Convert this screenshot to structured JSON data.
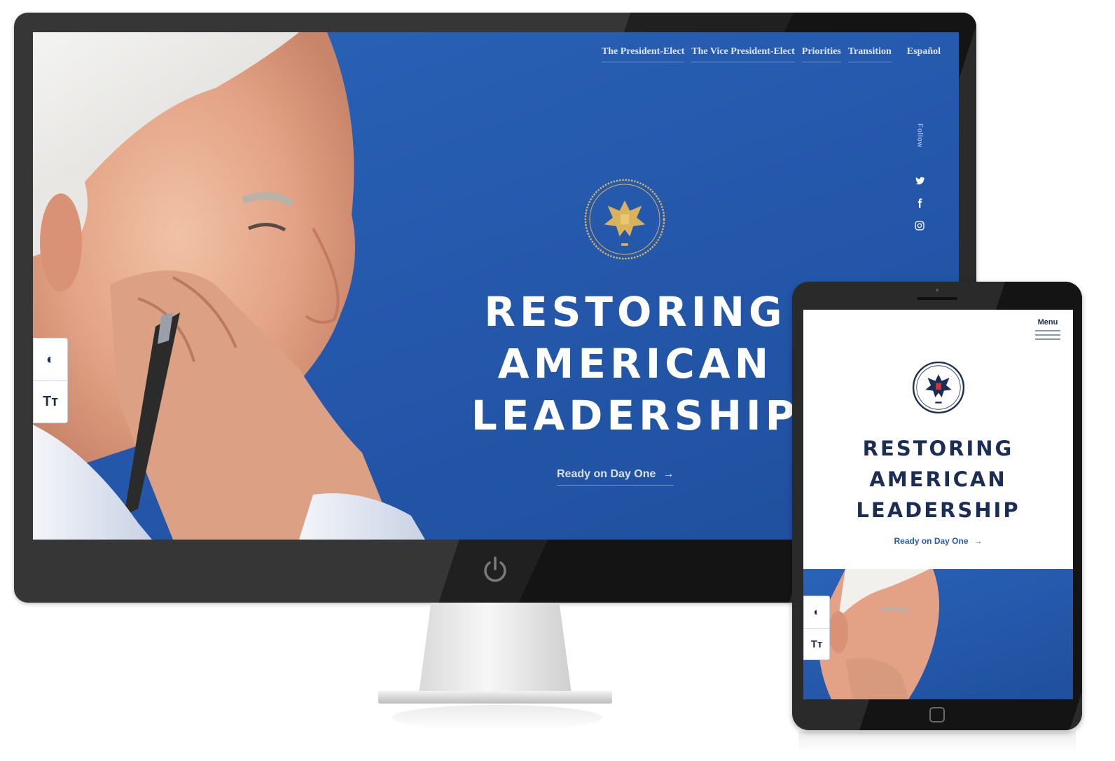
{
  "desktop": {
    "nav": {
      "items": [
        {
          "label": "The President-Elect"
        },
        {
          "label": "The Vice President-Elect"
        },
        {
          "label": "Priorities"
        },
        {
          "label": "Transition"
        }
      ],
      "language": "Español"
    },
    "follow": {
      "label": "Follow",
      "icons": [
        "twitter-icon",
        "facebook-icon",
        "instagram-icon"
      ]
    },
    "hero": {
      "title_lines": [
        "RESTORING",
        "AMERICAN",
        "LEADERSHIP"
      ],
      "cta": "Ready on Day One",
      "cta_arrow": "→"
    },
    "accessibility": {
      "contrast_icon": "◐",
      "text_size_label": "Tт"
    }
  },
  "tablet": {
    "menu_label": "Menu",
    "hero": {
      "title_lines": [
        "RESTORING",
        "AMERICAN",
        "LEADERSHIP"
      ],
      "cta": "Ready on Day One",
      "cta_arrow": "→"
    },
    "accessibility": {
      "contrast_icon": "◐",
      "text_size_label": "Tт"
    }
  },
  "colors": {
    "brand_blue": "#2457aa",
    "navy": "#1b2d55",
    "seal_gold": "#d9b25c",
    "white": "#ffffff"
  }
}
